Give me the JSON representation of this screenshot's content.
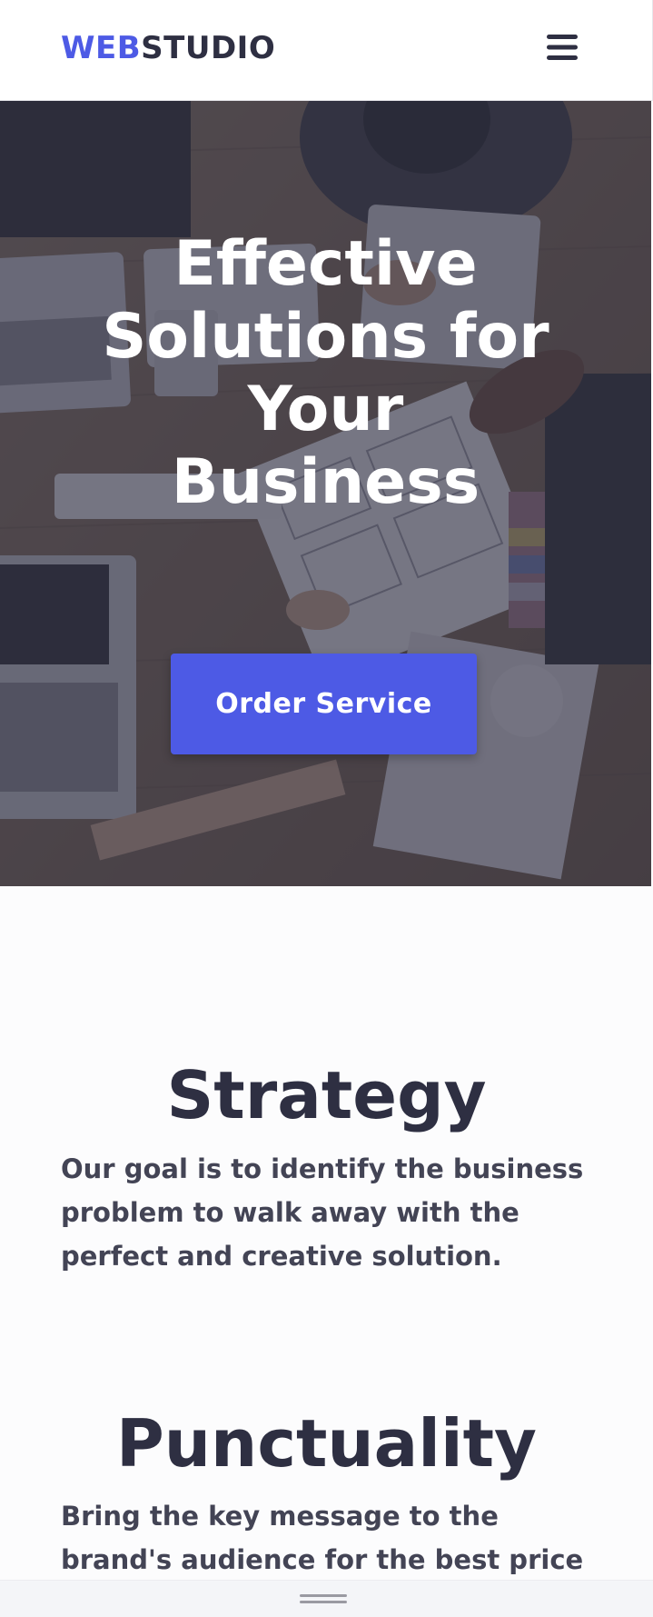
{
  "header": {
    "logo_part1": "WEB",
    "logo_part2": "STUDIO",
    "menu_icon": "hamburger-menu-icon"
  },
  "hero": {
    "title": "Effective Solutions for Your Business",
    "button_label": "Order Service",
    "background_image": "photo of team working at desk with laptops and documents"
  },
  "features": [
    {
      "title": "Strategy",
      "text": "Our goal is to identify the business problem to walk away with the perfect and creative solution."
    },
    {
      "title": "Punctuality",
      "text": "Bring the key message to the brand's audience for the best price within the"
    }
  ],
  "bottom_bar": {
    "icon": "drag-handle-icon"
  },
  "colors": {
    "accent": "#4d5ae5",
    "dark_text": "#2e2f42",
    "body_text": "#434455",
    "overlay": "#2e2f42"
  }
}
